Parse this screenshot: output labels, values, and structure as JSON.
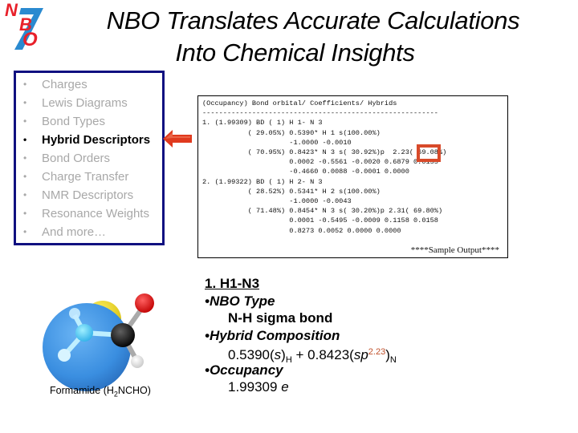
{
  "logo": {
    "letters": [
      "N",
      "B",
      "O"
    ],
    "digit": "7",
    "colors": {
      "letters": "#e8202a",
      "digit": "#2a8ad0"
    }
  },
  "title": {
    "line1": "NBO Translates Accurate Calculations",
    "line2": "Into Chemical Insights"
  },
  "topics": {
    "bullet": "•",
    "items": [
      {
        "label": "Charges",
        "active": false
      },
      {
        "label": "Lewis Diagrams",
        "active": false
      },
      {
        "label": "Bond Types",
        "active": false
      },
      {
        "label": "Hybrid Descriptors",
        "active": true
      },
      {
        "label": "Bond Orders",
        "active": false
      },
      {
        "label": "Charge Transfer",
        "active": false
      },
      {
        "label": "NMR Descriptors",
        "active": false
      },
      {
        "label": "Resonance Weights",
        "active": false
      },
      {
        "label": "And more…",
        "active": false
      }
    ],
    "border_color": "#101080",
    "inactive_color": "#a8a8a8"
  },
  "pointer": {
    "icon": "left-arrow-icon",
    "color": "#e03a1e"
  },
  "sample_output": {
    "lines": [
      "(Occupancy) Bond orbital/ Coefficients/ Hybrids",
      "---------------------------------------------------------",
      "1. (1.99309) BD ( 1) H 1- N 3",
      "           ( 29.05%) 0.5390* H 1 s(100.00%)",
      "                     -1.0000 -0.0010",
      "           ( 70.95%) 0.8423* N 3 s( 30.92%)p  2.23( 69.08%)",
      "                     0.0002 -0.5561 -0.0020 0.6879 0.0155",
      "                     -0.4660 0.0088 -0.0001 0.0000",
      "2. (1.99322) BD ( 1) H 2- N 3",
      "           ( 28.52%) 0.5341* H 2 s(100.00%)",
      "                     -1.0000 -0.0043",
      "           ( 71.48%) 0.8454* N 3 s( 30.20%)p 2.31( 69.80%)",
      "                     0.0001 -0.5495 -0.0009 0.1158 0.0158",
      "                     0.8273 0.0052 0.0000 0.0000"
    ],
    "highlighted_value": "2.23",
    "highlight_color": "#d84a2a",
    "caption": "****Sample Output****"
  },
  "molecule": {
    "name": "Formamide",
    "formula_prefix": "(H",
    "formula_sub": "2",
    "formula_suffix": "NCHO)",
    "atom_colors": {
      "nbo_lobe": "#3a8ee0",
      "yellow_lobe": "#f2d820",
      "nitrogen": "#40c0f0",
      "carbon": "#202020",
      "oxygen": "#e01010",
      "hydrogen": "#f0f0f0"
    }
  },
  "analysis": {
    "heading": "1. H1-N3",
    "bullet": "•",
    "nbo_type_label": "NBO Type",
    "nbo_type_value": "N-H sigma bond",
    "hybrid_label": "Hybrid Composition",
    "hybrid": {
      "coef_h": "0.5390(",
      "orb_h": "s",
      "close_h": ")",
      "sub_h": "H",
      "plus": " + 0.8423(",
      "orb_n": "sp",
      "exp_n": "2.23",
      "close_n": ")",
      "sub_n": "N"
    },
    "occupancy_label": "Occupancy",
    "occupancy_value": "1.99309",
    "occupancy_unit": "e"
  }
}
